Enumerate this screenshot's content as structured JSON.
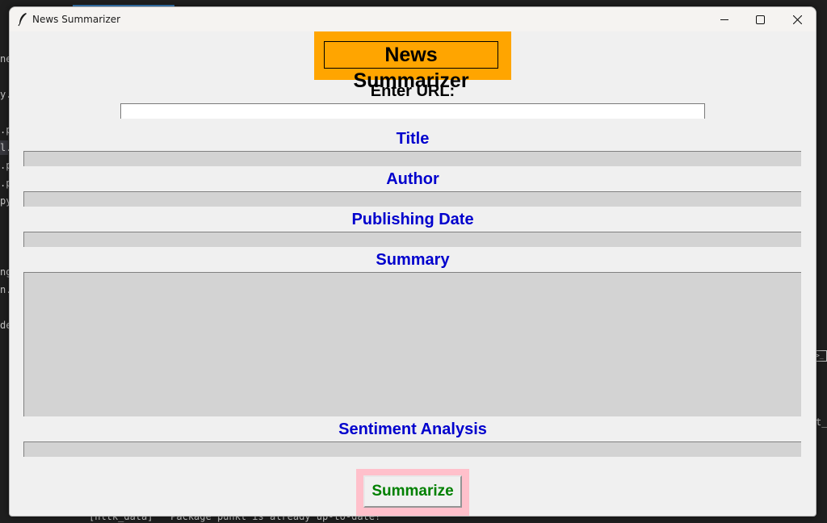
{
  "window": {
    "title": "News Summarizer",
    "controls": [
      "minimize",
      "maximize",
      "close"
    ]
  },
  "header": {
    "title": "News Summarizer",
    "background": "#ffa500"
  },
  "url": {
    "label": "Enter URL:",
    "value": ""
  },
  "fields": {
    "title_label": "Title",
    "title_value": "",
    "author_label": "Author",
    "author_value": "",
    "date_label": "Publishing Date",
    "date_value": "",
    "summary_label": "Summary",
    "summary_value": "",
    "sentiment_label": "Sentiment Analysis",
    "sentiment_value": ""
  },
  "button": {
    "label": "Summarize",
    "frame_color": "#ffc0cb",
    "text_color": "#008000"
  },
  "colors": {
    "field_label": "#0000cd",
    "field_bg": "#d3d3d3"
  },
  "background": {
    "fragments": [
      "ne",
      "y.p",
      ".p",
      "l.p",
      ".p",
      ".p",
      "py",
      "ng",
      "n.",
      "de",
      "t_c"
    ],
    "terminal": "[nltk_data]   Package punkt is already up-to-date!"
  }
}
